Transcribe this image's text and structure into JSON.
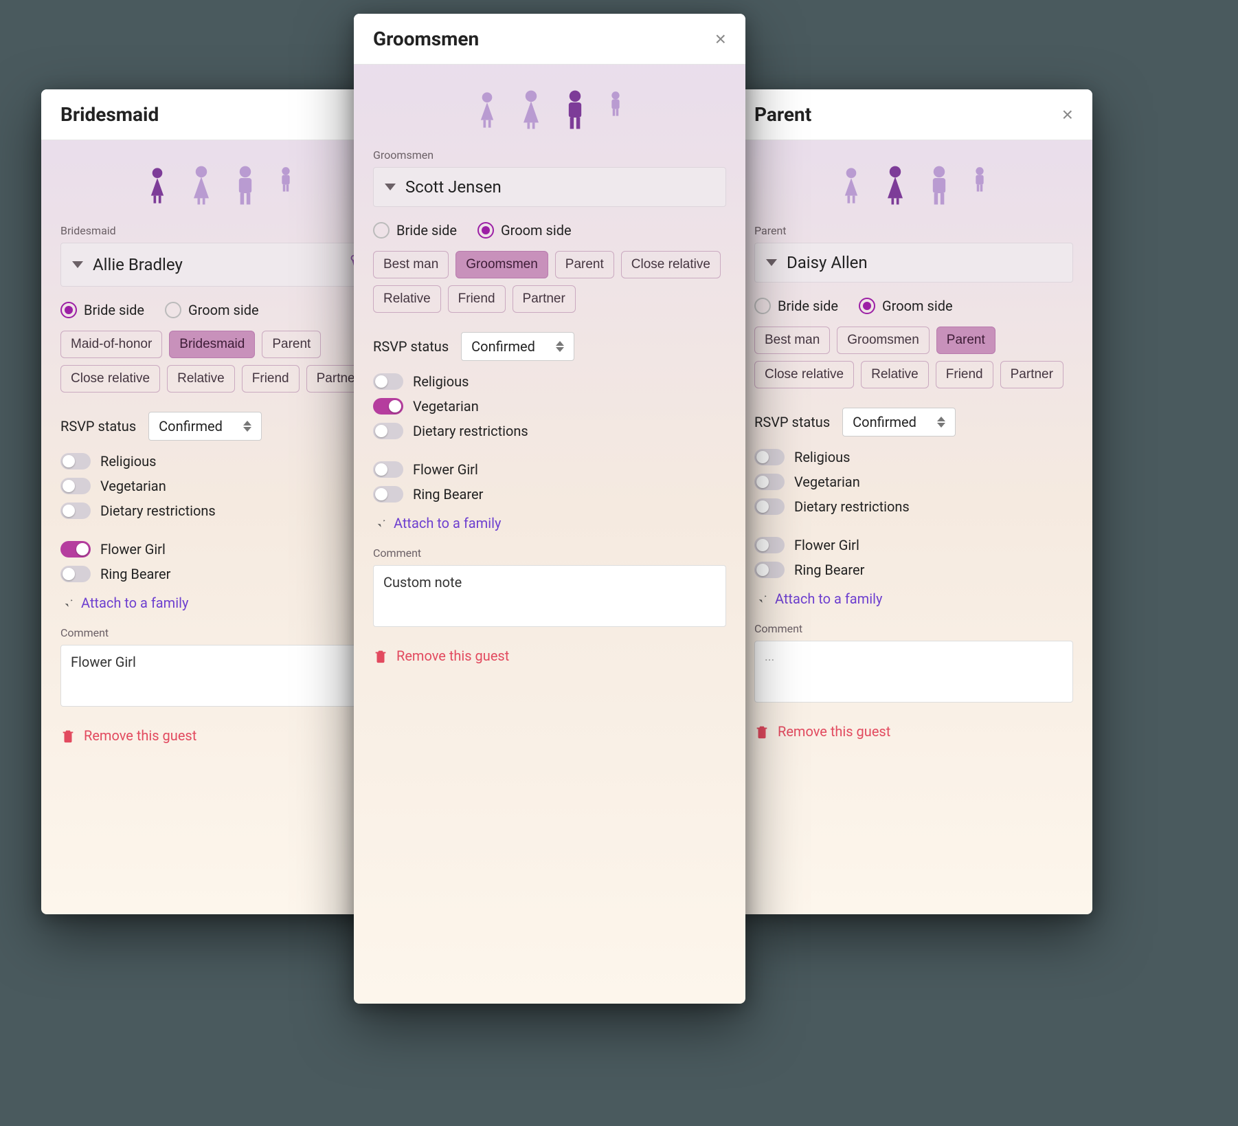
{
  "common": {
    "rsvp_label": "RSVP status",
    "religious": "Religious",
    "vegetarian": "Vegetarian",
    "dietary": "Dietary restrictions",
    "flower_girl": "Flower Girl",
    "ring_bearer": "Ring Bearer",
    "attach": "Attach to a family",
    "comment_label": "Comment",
    "remove": "Remove this guest",
    "bride_side": "Bride side",
    "groom_side": "Groom side",
    "rsvp_value": "Confirmed"
  },
  "roles_bride": [
    "Maid-of-honor",
    "Bridesmaid",
    "Parent",
    "Close relative",
    "Relative",
    "Friend",
    "Partner"
  ],
  "roles_groom": [
    "Best man",
    "Groomsmen",
    "Parent",
    "Close relative",
    "Relative",
    "Friend",
    "Partner"
  ],
  "cards": {
    "left": {
      "title": "Bridesmaid",
      "role_label": "Bridesmaid",
      "name": "Allie Bradley",
      "side": "bride",
      "avatar_selected": 0,
      "selected_role": "Bridesmaid",
      "has_bouquet": true,
      "toggles": {
        "religious": false,
        "vegetarian": false,
        "dietary": false,
        "flower_girl": true,
        "ring_bearer": false
      },
      "comment": "Flower Girl"
    },
    "center": {
      "title": "Groomsmen",
      "role_label": "Groomsmen",
      "name": "Scott Jensen",
      "side": "groom",
      "avatar_selected": 2,
      "selected_role": "Groomsmen",
      "has_bouquet": false,
      "toggles": {
        "religious": false,
        "vegetarian": true,
        "dietary": false,
        "flower_girl": false,
        "ring_bearer": false
      },
      "comment": "Custom note"
    },
    "right": {
      "title": "Parent",
      "role_label": "Parent",
      "name": "Daisy Allen",
      "side": "groom",
      "avatar_selected": 1,
      "selected_role": "Parent",
      "has_bouquet": false,
      "toggles": {
        "religious": false,
        "vegetarian": false,
        "dietary": false,
        "flower_girl": false,
        "ring_bearer": false
      },
      "comment": "..."
    }
  }
}
